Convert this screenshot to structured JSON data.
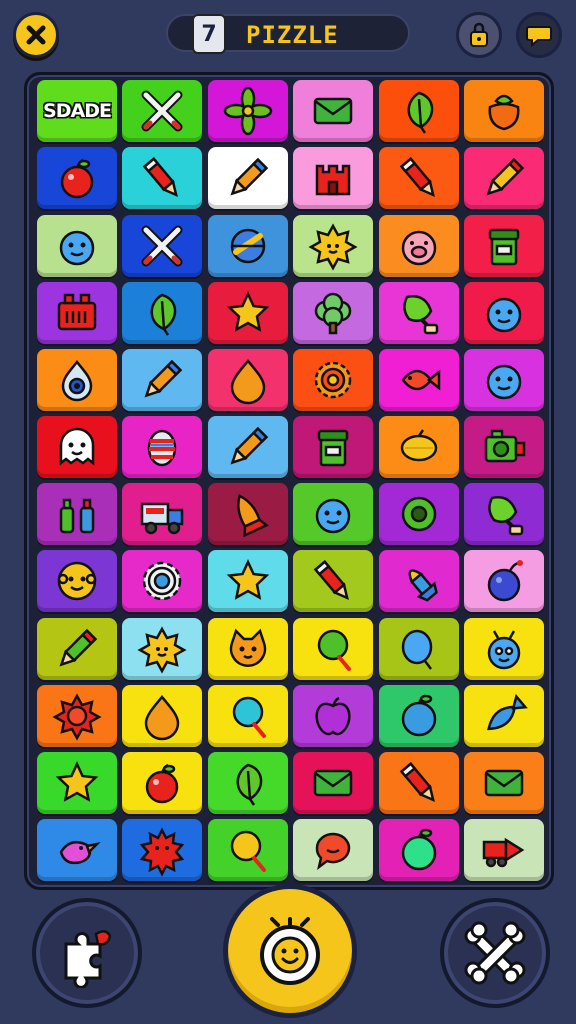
{
  "header": {
    "title": "PIZZLE",
    "level_badge": "7",
    "close_icon": "close-icon",
    "lock_icon": "lock-icon",
    "chat_icon": "chat-icon",
    "accent_color": "#f6c51c"
  },
  "board": {
    "rows": [
      [
        {
          "name": "text-tile",
          "text": "SDADE",
          "bg": "#5fdc1c"
        },
        {
          "name": "crossed-swords",
          "bg": "#44d11b"
        },
        {
          "name": "leaf-flower",
          "bg": "#d316d8"
        },
        {
          "name": "green-envelope",
          "bg": "#ef7fd8"
        },
        {
          "name": "green-leaf",
          "bg": "#fb4f0b"
        },
        {
          "name": "orange-fruit",
          "bg": "#fa8412"
        }
      ],
      [
        {
          "name": "red-apple",
          "bg": "#1746d9"
        },
        {
          "name": "red-pencil",
          "bg": "#2ad1d8"
        },
        {
          "name": "orange-pencil",
          "bg": "#ffffff"
        },
        {
          "name": "red-castle",
          "bg": "#f99bdd"
        },
        {
          "name": "red-pencil",
          "bg": "#fc5a12"
        },
        {
          "name": "yellow-pencil",
          "bg": "#fa2a74"
        }
      ],
      [
        {
          "name": "blue-blob",
          "bg": "#b7e08f"
        },
        {
          "name": "crossed-swords",
          "bg": "#1746d9"
        },
        {
          "name": "blue-globe",
          "bg": "#3f93dd"
        },
        {
          "name": "yellow-sun",
          "bg": "#b9e48c"
        },
        {
          "name": "pink-pig",
          "bg": "#fb8c20"
        },
        {
          "name": "green-jar",
          "bg": "#f21f49"
        }
      ],
      [
        {
          "name": "red-machine",
          "bg": "#9c34e0"
        },
        {
          "name": "green-leaf",
          "bg": "#1c7fd8"
        },
        {
          "name": "yellow-star",
          "bg": "#e81d3d"
        },
        {
          "name": "tree-bush",
          "bg": "#c469e0"
        },
        {
          "name": "leaf-cup",
          "bg": "#e735d6"
        },
        {
          "name": "blue-blob",
          "bg": "#f11b4b"
        }
      ],
      [
        {
          "name": "blue-eye-drop",
          "bg": "#fb8c16"
        },
        {
          "name": "orange-pencil",
          "bg": "#5fb8f0"
        },
        {
          "name": "orange-drop",
          "bg": "#f3316c"
        },
        {
          "name": "orange-gear",
          "bg": "#fb4f14"
        },
        {
          "name": "red-fish",
          "bg": "#f01fd4"
        },
        {
          "name": "blue-blob",
          "bg": "#d832e0"
        }
      ],
      [
        {
          "name": "white-ghost",
          "bg": "#e8101d"
        },
        {
          "name": "striped-egg",
          "bg": "#e924c7"
        },
        {
          "name": "orange-pencil",
          "bg": "#5fb8f0"
        },
        {
          "name": "green-jar",
          "bg": "#bf1876"
        },
        {
          "name": "yellow-lemon",
          "bg": "#fc8c16"
        },
        {
          "name": "green-camera",
          "bg": "#c51b86"
        }
      ],
      [
        {
          "name": "two-bottles",
          "bg": "#a92fb9"
        },
        {
          "name": "blue-truck",
          "bg": "#e11e8e"
        },
        {
          "name": "orange-rocket",
          "bg": "#9a1c44"
        },
        {
          "name": "blue-blob",
          "bg": "#56c92a"
        },
        {
          "name": "green-ring",
          "bg": "#a329d6"
        },
        {
          "name": "leaf-cup",
          "bg": "#8e2bd3"
        }
      ],
      [
        {
          "name": "yellow-face",
          "bg": "#7b36d3"
        },
        {
          "name": "white-gear",
          "bg": "#e629c9"
        },
        {
          "name": "yellow-star",
          "bg": "#5fdbe9"
        },
        {
          "name": "red-pencil",
          "bg": "#a3c91d"
        },
        {
          "name": "brush-rocket",
          "bg": "#e029ce"
        },
        {
          "name": "blue-bomb",
          "bg": "#f59de3"
        }
      ],
      [
        {
          "name": "green-pencil",
          "bg": "#b5c514"
        },
        {
          "name": "yellow-sun",
          "bg": "#8ce0ef"
        },
        {
          "name": "orange-cat",
          "bg": "#f7e10f"
        },
        {
          "name": "green-lollipop",
          "bg": "#f7e10f"
        },
        {
          "name": "blue-drop",
          "bg": "#a7c516"
        },
        {
          "name": "blue-bug",
          "bg": "#f7e10f"
        }
      ],
      [
        {
          "name": "red-sun",
          "bg": "#f97516"
        },
        {
          "name": "orange-drop",
          "bg": "#f7e10f"
        },
        {
          "name": "blue-lollipop",
          "bg": "#f7e10f"
        },
        {
          "name": "purple-apple",
          "bg": "#b33bd8"
        },
        {
          "name": "blue-apple",
          "bg": "#2ec86a"
        },
        {
          "name": "blue-fish",
          "bg": "#f7e10f"
        }
      ],
      [
        {
          "name": "yellow-star",
          "bg": "#39d92c"
        },
        {
          "name": "red-apple",
          "bg": "#f7e10f"
        },
        {
          "name": "green-leaf",
          "bg": "#45d92a"
        },
        {
          "name": "green-envelope",
          "bg": "#e5125a"
        },
        {
          "name": "red-pencil",
          "bg": "#f97516"
        },
        {
          "name": "green-envelope",
          "bg": "#fa7f18"
        }
      ],
      [
        {
          "name": "pink-bird",
          "bg": "#2e8ae6"
        },
        {
          "name": "red-spiky",
          "bg": "#1f6be0"
        },
        {
          "name": "yellow-lollipop",
          "bg": "#44d12a"
        },
        {
          "name": "red-chat",
          "bg": "#c9e4b7"
        },
        {
          "name": "green-apple",
          "bg": "#e321b4"
        },
        {
          "name": "red-arrow-truck",
          "bg": "#c9e4b7"
        }
      ]
    ]
  },
  "bottom": {
    "left_icon": "puzzle-piece-icon",
    "center_icon": "smiley-bomb-icon",
    "right_icon": "crossed-bones-icon"
  }
}
